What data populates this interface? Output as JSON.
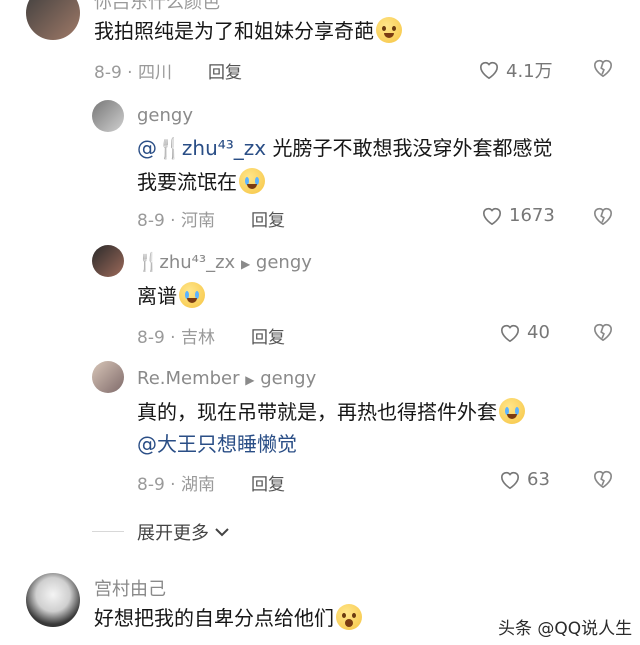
{
  "top_comment": {
    "cut_name": "你吕东什么颜色",
    "text": "我拍照纯是为了和姐妹分享奇葩",
    "date": "8-9",
    "location": "四川",
    "reply_label": "回复",
    "likes": "4.1万"
  },
  "replies": [
    {
      "name": "gengy",
      "mention": "@🍴zhu⁴³_zx",
      "line1": "光膀子不敢想我没穿外套都感觉",
      "line2": "我要流氓在",
      "date": "8-9",
      "location": "河南",
      "reply_label": "回复",
      "likes": "1673"
    },
    {
      "name": "🍴zhu⁴³_zx",
      "arrow": "▶",
      "target": "gengy",
      "text": "离谱",
      "date": "8-9",
      "location": "吉林",
      "reply_label": "回复",
      "likes": "40"
    },
    {
      "name": "Re.Member",
      "arrow": "▶",
      "target": "gengy",
      "line1": "真的，现在吊带就是，再热也得搭件外套",
      "mention": "@大王只想睡懒觉",
      "date": "8-9",
      "location": "湖南",
      "reply_label": "回复",
      "likes": "63"
    }
  ],
  "expand": {
    "label": "展开更多",
    "icon": "chevron-down-icon"
  },
  "bottom_comment": {
    "name": "宫村由己",
    "text": "好想把我的自卑分点给他们"
  },
  "watermark": "头条 @QQ说人生",
  "colors": {
    "mention": "#2a4e86",
    "meta": "#9a9a9a"
  }
}
